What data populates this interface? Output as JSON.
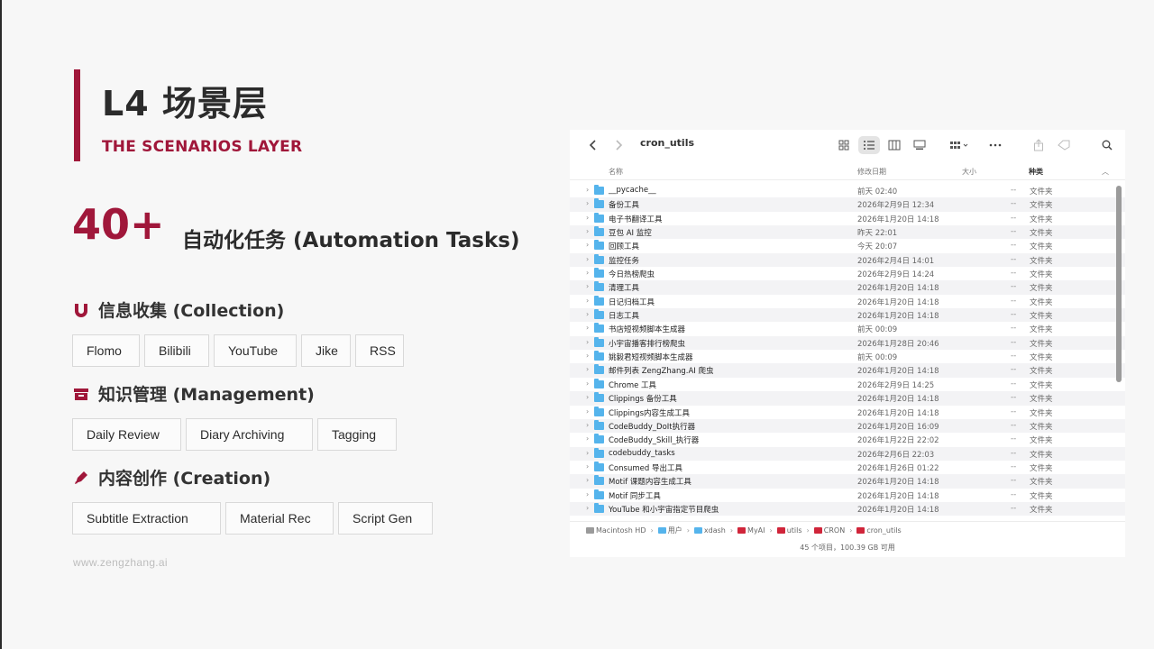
{
  "slide": {
    "title": "L4 场景层",
    "subtitle": "THE SCENARIOS LAYER",
    "big_number": "40+",
    "big_caption": "自动化任务 (Automation Tasks)",
    "footer": "www.zengzhang.ai",
    "accent_color": "#a0173a"
  },
  "sections": [
    {
      "icon": "magnet-icon",
      "title": "信息收集 (Collection)",
      "tags": [
        "Flomo",
        "Bilibili",
        "YouTube",
        "Jike",
        "RSS"
      ]
    },
    {
      "icon": "archive-box-icon",
      "title": "知识管理 (Management)",
      "tags": [
        "Daily Review",
        "Diary Archiving",
        "Tagging"
      ]
    },
    {
      "icon": "pen-icon",
      "title": "内容创作 (Creation)",
      "tags": [
        "Subtitle Extraction",
        "Material Rec",
        "Script Gen"
      ]
    }
  ],
  "finder": {
    "window_title": "cron_utils",
    "columns": {
      "name": "名称",
      "date": "修改日期",
      "size": "大小",
      "kind": "种类"
    },
    "rows": [
      {
        "name": "__pycache__",
        "date": "前天 02:40",
        "size": "--",
        "kind": "文件夹"
      },
      {
        "name": "备份工具",
        "date": "2026年2月9日 12:34",
        "size": "--",
        "kind": "文件夹"
      },
      {
        "name": "电子书翻译工具",
        "date": "2026年1月20日 14:18",
        "size": "--",
        "kind": "文件夹"
      },
      {
        "name": "豆包 AI 监控",
        "date": "昨天 22:01",
        "size": "--",
        "kind": "文件夹"
      },
      {
        "name": "回顾工具",
        "date": "今天 20:07",
        "size": "--",
        "kind": "文件夹"
      },
      {
        "name": "监控任务",
        "date": "2026年2月4日 14:01",
        "size": "--",
        "kind": "文件夹"
      },
      {
        "name": "今日热榜爬虫",
        "date": "2026年2月9日 14:24",
        "size": "--",
        "kind": "文件夹"
      },
      {
        "name": "清理工具",
        "date": "2026年1月20日 14:18",
        "size": "--",
        "kind": "文件夹"
      },
      {
        "name": "日记归档工具",
        "date": "2026年1月20日 14:18",
        "size": "--",
        "kind": "文件夹"
      },
      {
        "name": "日志工具",
        "date": "2026年1月20日 14:18",
        "size": "--",
        "kind": "文件夹"
      },
      {
        "name": "书店短视频脚本生成器",
        "date": "前天 00:09",
        "size": "--",
        "kind": "文件夹"
      },
      {
        "name": "小宇宙播客排行榜爬虫",
        "date": "2026年1月28日 20:46",
        "size": "--",
        "kind": "文件夹"
      },
      {
        "name": "姚毅君短视频脚本生成器",
        "date": "前天 00:09",
        "size": "--",
        "kind": "文件夹"
      },
      {
        "name": "邮件列表 ZengZhang.AI 爬虫",
        "date": "2026年1月20日 14:18",
        "size": "--",
        "kind": "文件夹"
      },
      {
        "name": "Chrome 工具",
        "date": "2026年2月9日 14:25",
        "size": "--",
        "kind": "文件夹"
      },
      {
        "name": "Clippings 备份工具",
        "date": "2026年1月20日 14:18",
        "size": "--",
        "kind": "文件夹"
      },
      {
        "name": "Clippings内容生成工具",
        "date": "2026年1月20日 14:18",
        "size": "--",
        "kind": "文件夹"
      },
      {
        "name": "CodeBuddy_DoIt执行器",
        "date": "2026年1月20日 16:09",
        "size": "--",
        "kind": "文件夹"
      },
      {
        "name": "CodeBuddy_Skill_执行器",
        "date": "2026年1月22日 22:02",
        "size": "--",
        "kind": "文件夹"
      },
      {
        "name": "codebuddy_tasks",
        "date": "2026年2月6日 22:03",
        "size": "--",
        "kind": "文件夹"
      },
      {
        "name": "Consumed 导出工具",
        "date": "2026年1月26日 01:22",
        "size": "--",
        "kind": "文件夹"
      },
      {
        "name": "Motif 课题内容生成工具",
        "date": "2026年1月20日 14:18",
        "size": "--",
        "kind": "文件夹"
      },
      {
        "name": "Motif 同步工具",
        "date": "2026年1月20日 14:18",
        "size": "--",
        "kind": "文件夹"
      },
      {
        "name": "YouTube 和小宇宙指定节目爬虫",
        "date": "2026年1月20日 14:18",
        "size": "--",
        "kind": "文件夹"
      }
    ],
    "path": [
      {
        "label": "Macintosh HD",
        "color": "#9a9a9a"
      },
      {
        "label": "用户",
        "color": "#55b4ec"
      },
      {
        "label": "xdash",
        "color": "#55b4ec"
      },
      {
        "label": "MyAI",
        "color": "#d0253a"
      },
      {
        "label": "utils",
        "color": "#d0253a"
      },
      {
        "label": "CRON",
        "color": "#d0253a"
      },
      {
        "label": "cron_utils",
        "color": "#d0253a"
      }
    ],
    "status": "45 个项目，100.39 GB 可用",
    "folder_color": "#55b4ec"
  }
}
